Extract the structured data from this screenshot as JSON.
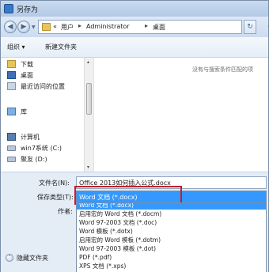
{
  "window": {
    "title": "另存为"
  },
  "nav": {
    "back_symbol": "◀",
    "forward_symbol": "▶",
    "dropdown_symbol": "▼",
    "address": {
      "overflow": "«",
      "crumbs": [
        "用户",
        "Administrator",
        "桌面"
      ],
      "separator": "▸",
      "dropdown_symbol": "▾"
    },
    "refresh_symbol": "↻"
  },
  "toolbar": {
    "organize_label": "组织 ▾",
    "new_folder_label": "新建文件夹"
  },
  "sidebar": {
    "items": [
      {
        "label": "下载",
        "icon": "download-folder-icon"
      },
      {
        "label": "桌面",
        "icon": "desktop-icon"
      },
      {
        "label": "最近访问的位置",
        "icon": "recent-places-icon"
      },
      {
        "label": "库",
        "icon": "library-icon"
      },
      {
        "label": "计算机",
        "icon": "computer-icon"
      },
      {
        "label": "win7系统 (C:)",
        "icon": "drive-icon"
      },
      {
        "label": "聚友 (D:)",
        "icon": "drive-icon"
      }
    ],
    "scroll_up": "▴",
    "scroll_down": "▾"
  },
  "content": {
    "empty_message": "没有与搜索条件匹配的项"
  },
  "form": {
    "filename_label": "文件名(N):",
    "filename_value": "Office 2013如何插入公式.docx",
    "type_label": "保存类型(T):",
    "type_value": "Word 文档 (*.docx)",
    "author_label": "作者:"
  },
  "type_options": [
    "Word 文档 (*.docx)",
    "启用宏的 Word 文档 (*.docm)",
    "Word 97-2003 文档 (*.doc)",
    "Word 模板 (*.dotx)",
    "启用宏的 Word 模板 (*.dotm)",
    "Word 97-2003 模板 (*.dot)",
    "PDF (*.pdf)",
    "XPS 文档 (*.xps)"
  ],
  "hide_folders": {
    "symbol": "⌃",
    "label": "隐藏文件夹"
  },
  "colors": {
    "selection": "#3399ff",
    "highlight_border": "#c0202a"
  }
}
